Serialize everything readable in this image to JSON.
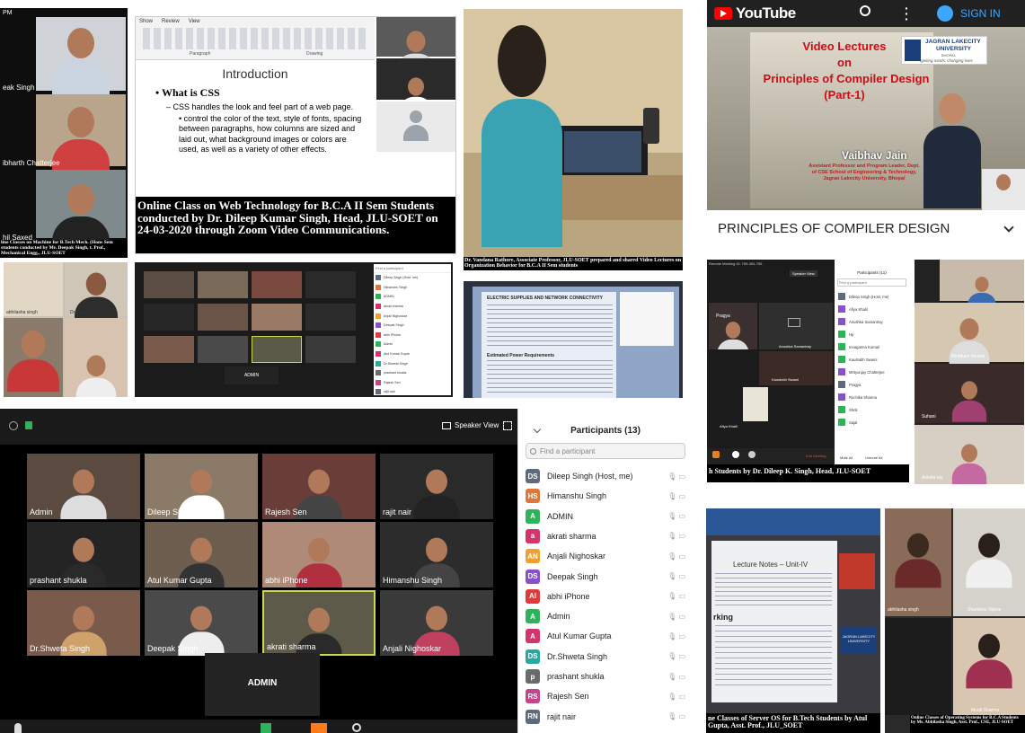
{
  "top_left": {
    "status_time": "PM",
    "names": [
      "eak Singh",
      "ibharth Chatterjee",
      "hil Saxed"
    ],
    "caption": "line Classes on Machine for B.Tech Mech. (Hons Sem students conducted by Mr. Deepak Singh, t. Prof., Mechanical Engg., JLU-SOET"
  },
  "css_slide": {
    "ribbon_items": [
      "Show",
      "Review",
      "View"
    ],
    "ribbon_group": "Paragraph",
    "ribbon_group2": "Drawing",
    "title": "Introduction",
    "bullet": "• What is CSS",
    "sub": "– CSS handles the look and feel part of a web page.",
    "sub2": "• control the color of the text, style of fonts, spacing between paragraphs, how columns are sized and laid out, what background images or colors are used, as well as a variety of other effects.",
    "caption": "Online Class on Web Technology for B.C.A II Sem Students conducted by Dr. Dileep Kumar Singh, Head, JLU-SOET on 24-03-2020 through Zoom Video Communications."
  },
  "ob_photo": {
    "caption": "Dr. Vandana Rathore, Associate Professor, JLU-SOET prepared and shared Video Lectures on Organization Behavior for B.C.A II Sem students"
  },
  "youtube": {
    "brand": "YouTube",
    "sign_in": "SIGN IN",
    "video_line1": "Video Lectures",
    "video_line2": "on",
    "video_line3": "Principles of Compiler Design",
    "video_line4": "(Part-1)",
    "uni_line1": "JAGRAN LAKECITY",
    "uni_line2": "UNIVERSITY",
    "uni_line3": "BHOPAL",
    "uni_tagline": "Igniting minds; changing lives",
    "presenter": "Vaibhav Jain",
    "presenter_title": "Assistant Professor and Program Leader, Dept. of CSE School of Engineering & Technology, Jagran Lakecity University, Bhopal",
    "playlist_title": "PRINCIPLES OF COMPILER DESIGN"
  },
  "mid_left": {
    "names": [
      "abhilasha singh",
      "Dr.Shweta Singh"
    ]
  },
  "mid_zoom": {
    "admin_label": "ADMIN",
    "participant_header": "Find a participant",
    "list": [
      "Dileep Singh (Host, me)",
      "Himanshu Singh",
      "ADMIN",
      "akrati sharma",
      "Anjali Nighoskar",
      "Deepak Singh",
      "abhi iPhone",
      "Admin",
      "Atul Kumar Gupta",
      "Dr.Shweta Singh",
      "prashant shukla",
      "Rajesh Sen",
      "rajit nair"
    ]
  },
  "doc_screen": {
    "heading": "ELECTRIC SUPPLIES AND NETWORK CONNECTIVITY",
    "sub": "Estimated Power Requirements"
  },
  "zoom_main": {
    "speaker_view": "Speaker View",
    "participants_title": "Participants (13)",
    "find_placeholder": "Find a participant",
    "participants": [
      {
        "initials": "DS",
        "name": "Dileep Singh (Host, me)",
        "color": "#5f6b7a"
      },
      {
        "initials": "HS",
        "name": "Himanshu Singh",
        "color": "#e0773a"
      },
      {
        "initials": "A",
        "name": "ADMIN",
        "color": "#2fb35a"
      },
      {
        "initials": "a",
        "name": "akrati sharma",
        "color": "#d6336c"
      },
      {
        "initials": "AN",
        "name": "Anjali Nighoskar",
        "color": "#f0a030"
      },
      {
        "initials": "DS",
        "name": "Deepak Singh",
        "color": "#8a4fcf"
      },
      {
        "initials": "AI",
        "name": "abhi iPhone",
        "color": "#e03a3a"
      },
      {
        "initials": "A",
        "name": "Admin",
        "color": "#2fb35a"
      },
      {
        "initials": "A",
        "name": "Atul Kumar Gupta",
        "color": "#d6336c"
      },
      {
        "initials": "DS",
        "name": "Dr.Shweta Singh",
        "color": "#2aa8a0"
      },
      {
        "initials": "p",
        "name": "prashant shukla",
        "color": "#6a6a6a"
      },
      {
        "initials": "RS",
        "name": "Rajesh Sen",
        "color": "#c2448a"
      },
      {
        "initials": "RN",
        "name": "rajit nair",
        "color": "#5f6b7a"
      }
    ],
    "tiles": [
      "Admin",
      "Dileep Singh",
      "Rajesh Sen",
      "rajit nair",
      "prashant shukla",
      "Atul Kumar Gupta",
      "abhi iPhone",
      "Himanshu Singh",
      "Dr.Shweta Singh",
      "Deepak Singh",
      "akrati sharma",
      "Anjali Nighoskar"
    ],
    "admin_tile": "ADMIN"
  },
  "right_zoom": {
    "title": "Remote Meeting ID: 769-494-755",
    "speaker_view": "Speaker View",
    "participants_title": "Participants (11)",
    "find": "Find a participant",
    "list": [
      "Dileep Singh (Host, me)",
      "Afiya Khalil",
      "Anushka Samantray",
      "Hp",
      "Innaganna Kumari",
      "Kaustubh Swami",
      "Mrityunjay Chatterjee",
      "Pragya",
      "Ruchika Sharma",
      "Shrik",
      "Sajal"
    ],
    "tile_pragya": "Pragya",
    "tile_kaustubh": "Kaustubh Swami",
    "tile_anushka": "Anushka Samantray",
    "tile_afiya": "Afiya Khalil",
    "end_meeting": "End Meeting",
    "mute_all": "Mute All",
    "unmute_all": "Unmute All",
    "caption": "h Students by Dr. Dileep K. Singh, Head, JLU-SOET",
    "names": [
      "Shubham Meena",
      "Suhani",
      "Anisha roy"
    ]
  },
  "lecture_notes": {
    "title": "Lecture Notes – Unit-IV",
    "working": "rking",
    "caption": "ne Classes of Server OS for B.Tech Students by Atul Gupta, Asst. Prof., JLU_SOET",
    "logo1": "JAGRAN LAKECITY",
    "logo2": "UNIVERSITY"
  },
  "os_class": {
    "names": [
      "abhilasha singh",
      "Shantanu Vajwar",
      "Mudit Sharma"
    ],
    "caption": "Online Classes of Operating Systems for B.C.A Students by Ms. Abhilasha Singh, Asst. Prof., CSE, JLU-SOET"
  }
}
